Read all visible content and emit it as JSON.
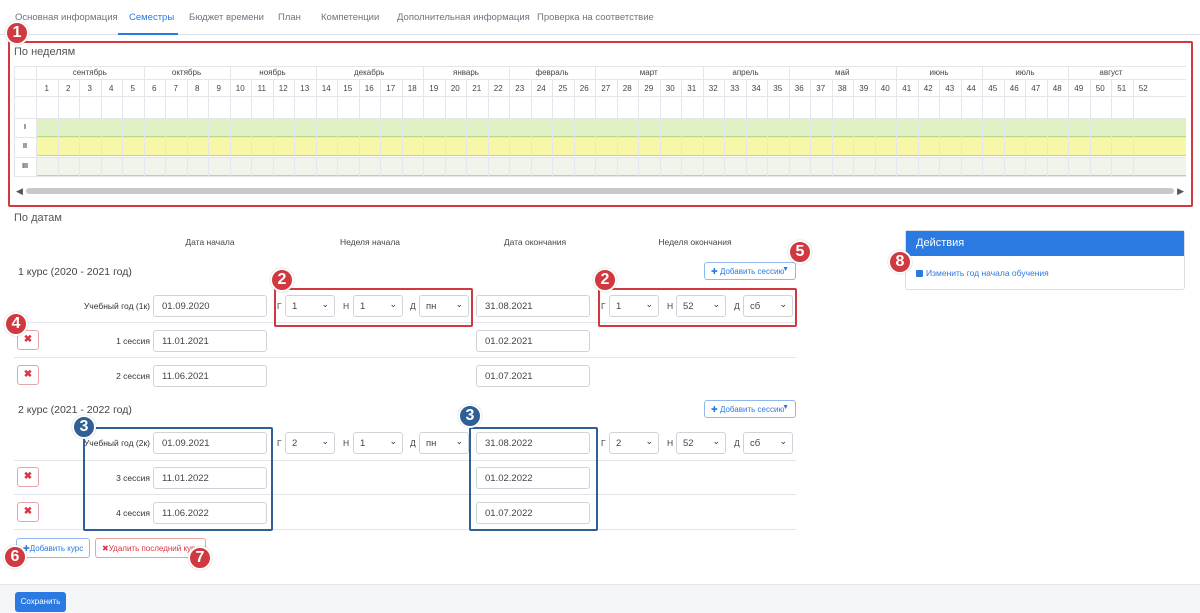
{
  "tabs": [
    {
      "label": "Основная информация"
    },
    {
      "label": "Семестры"
    },
    {
      "label": "Бюджет времени"
    },
    {
      "label": "План"
    },
    {
      "label": "Компетенции"
    },
    {
      "label": "Дополнительная информация"
    },
    {
      "label": "Проверка на соответствие"
    }
  ],
  "weeks_section": {
    "title": "По неделям",
    "months": [
      "сентябрь",
      "октябрь",
      "ноябрь",
      "декабрь",
      "январь",
      "февраль",
      "март",
      "апрель",
      "май",
      "июнь",
      "июль",
      "август"
    ],
    "month_week_counts": [
      5,
      4,
      4,
      5,
      4,
      4,
      5,
      4,
      5,
      4,
      4,
      4
    ],
    "weeks": [
      "1",
      "2",
      "3",
      "4",
      "5",
      "6",
      "7",
      "8",
      "9",
      "10",
      "11",
      "12",
      "13",
      "14",
      "15",
      "16",
      "17",
      "18",
      "19",
      "20",
      "21",
      "22",
      "23",
      "24",
      "25",
      "26",
      "27",
      "28",
      "29",
      "30",
      "31",
      "32",
      "33",
      "34",
      "35",
      "36",
      "37",
      "38",
      "39",
      "40",
      "41",
      "42",
      "43",
      "44",
      "45",
      "46",
      "47",
      "48",
      "49",
      "50",
      "51",
      "52"
    ],
    "rows": [
      "I",
      "II",
      "III"
    ]
  },
  "dates_section": {
    "title": "По датам",
    "headers": {
      "start_date": "Дата начала",
      "start_week": "Неделя начала",
      "end_date": "Дата окончания",
      "end_week": "Неделя окончания"
    },
    "labels": {
      "g": "Г",
      "n": "Н",
      "d": "Д"
    },
    "add_session": "Добавить сессию"
  },
  "courses": [
    {
      "title": "1 курс (2020 - 2021 год)",
      "year_label": "Учебный год (1к)",
      "start_date": "01.09.2020",
      "start_g": "1",
      "start_n": "1",
      "start_d": "пн",
      "end_date": "31.08.2021",
      "end_g": "1",
      "end_n": "52",
      "end_d": "сб",
      "sessions": [
        {
          "label": "1 сессия",
          "start": "11.01.2021",
          "end": "01.02.2021"
        },
        {
          "label": "2 сессия",
          "start": "11.06.2021",
          "end": "01.07.2021"
        }
      ]
    },
    {
      "title": "2 курс (2021 - 2022 год)",
      "year_label": "Учебный год (2к)",
      "start_date": "01.09.2021",
      "start_g": "2",
      "start_n": "1",
      "start_d": "пн",
      "end_date": "31.08.2022",
      "end_g": "2",
      "end_n": "52",
      "end_d": "сб",
      "sessions": [
        {
          "label": "3 сессия",
          "start": "11.01.2022",
          "end": "01.02.2022"
        },
        {
          "label": "4 сессия",
          "start": "11.06.2022",
          "end": "01.07.2022"
        }
      ]
    }
  ],
  "buttons": {
    "add_course": "Добавить курс",
    "delete_last_course": "Удалить последний курс",
    "save": "Сохранить"
  },
  "actions_panel": {
    "title": "Действия",
    "change_year_link": "Изменить год начала обучения"
  },
  "markers": [
    "1",
    "2",
    "2",
    "3",
    "3",
    "4",
    "5",
    "6",
    "7",
    "8"
  ],
  "colors": {
    "accent": "#2a7ae2",
    "band_I": "#dff0c4",
    "band_II": "#f7f7a8",
    "band_III": "#f0f5ec",
    "marker_red": "#d0393f",
    "marker_blue": "#2f5f95"
  }
}
